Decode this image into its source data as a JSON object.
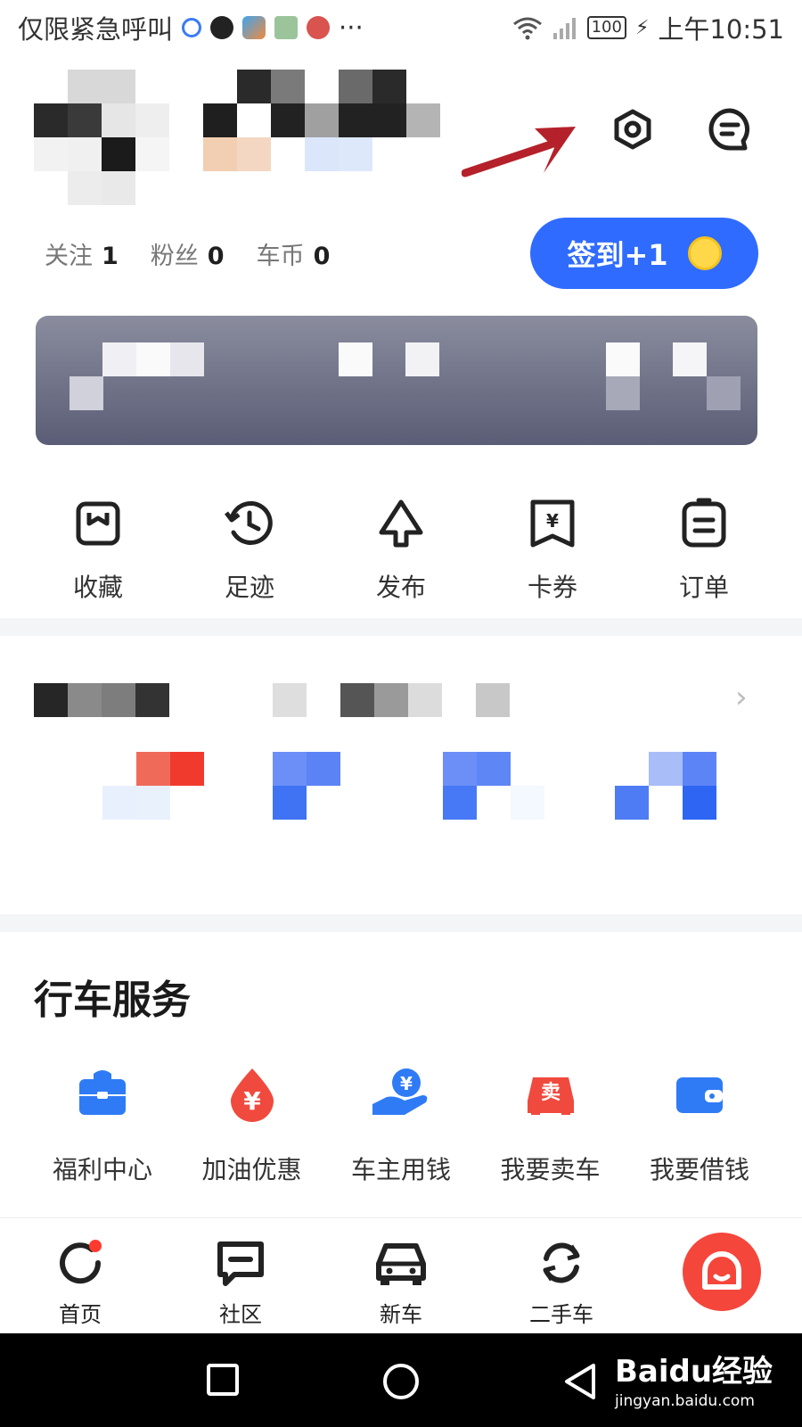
{
  "status_bar": {
    "left_text": "仅限紧急呼叫",
    "more": "···",
    "battery": "100",
    "time": "上午10:51"
  },
  "profile": {
    "stats": [
      {
        "label": "关注",
        "value": "1"
      },
      {
        "label": "粉丝",
        "value": "0"
      },
      {
        "label": "车币",
        "value": "0"
      }
    ],
    "checkin_label": "签到+1"
  },
  "quick_actions": [
    {
      "label": "收藏",
      "icon": "bookmark-icon"
    },
    {
      "label": "足迹",
      "icon": "history-clock-icon"
    },
    {
      "label": "发布",
      "icon": "upload-arrow-icon"
    },
    {
      "label": "卡券",
      "icon": "coupon-icon"
    },
    {
      "label": "订单",
      "icon": "order-list-icon"
    }
  ],
  "driving_services": {
    "title": "行车服务",
    "items": [
      {
        "label": "福利中心",
        "icon": "gift-bag-icon",
        "color": "#2f7bf5"
      },
      {
        "label": "加油优惠",
        "icon": "fuel-drop-icon",
        "color": "#f04a3e"
      },
      {
        "label": "车主用钱",
        "icon": "hand-money-icon",
        "color": "#2f7bf5"
      },
      {
        "label": "我要卖车",
        "icon": "sell-car-icon",
        "color": "#f04a3e"
      },
      {
        "label": "我要借钱",
        "icon": "wallet-icon",
        "color": "#2f7bf5"
      }
    ]
  },
  "tab_bar": {
    "tabs": [
      {
        "label": "首页",
        "icon": "home-refresh-icon"
      },
      {
        "label": "社区",
        "icon": "community-chat-icon"
      },
      {
        "label": "新车",
        "icon": "car-icon"
      },
      {
        "label": "二手车",
        "icon": "used-car-cycle-icon"
      }
    ]
  },
  "watermark": {
    "brand": "Baidu经验",
    "url": "jingyan.baidu.com"
  },
  "colors": {
    "accent": "#2f6bff",
    "red": "#f5463c"
  }
}
